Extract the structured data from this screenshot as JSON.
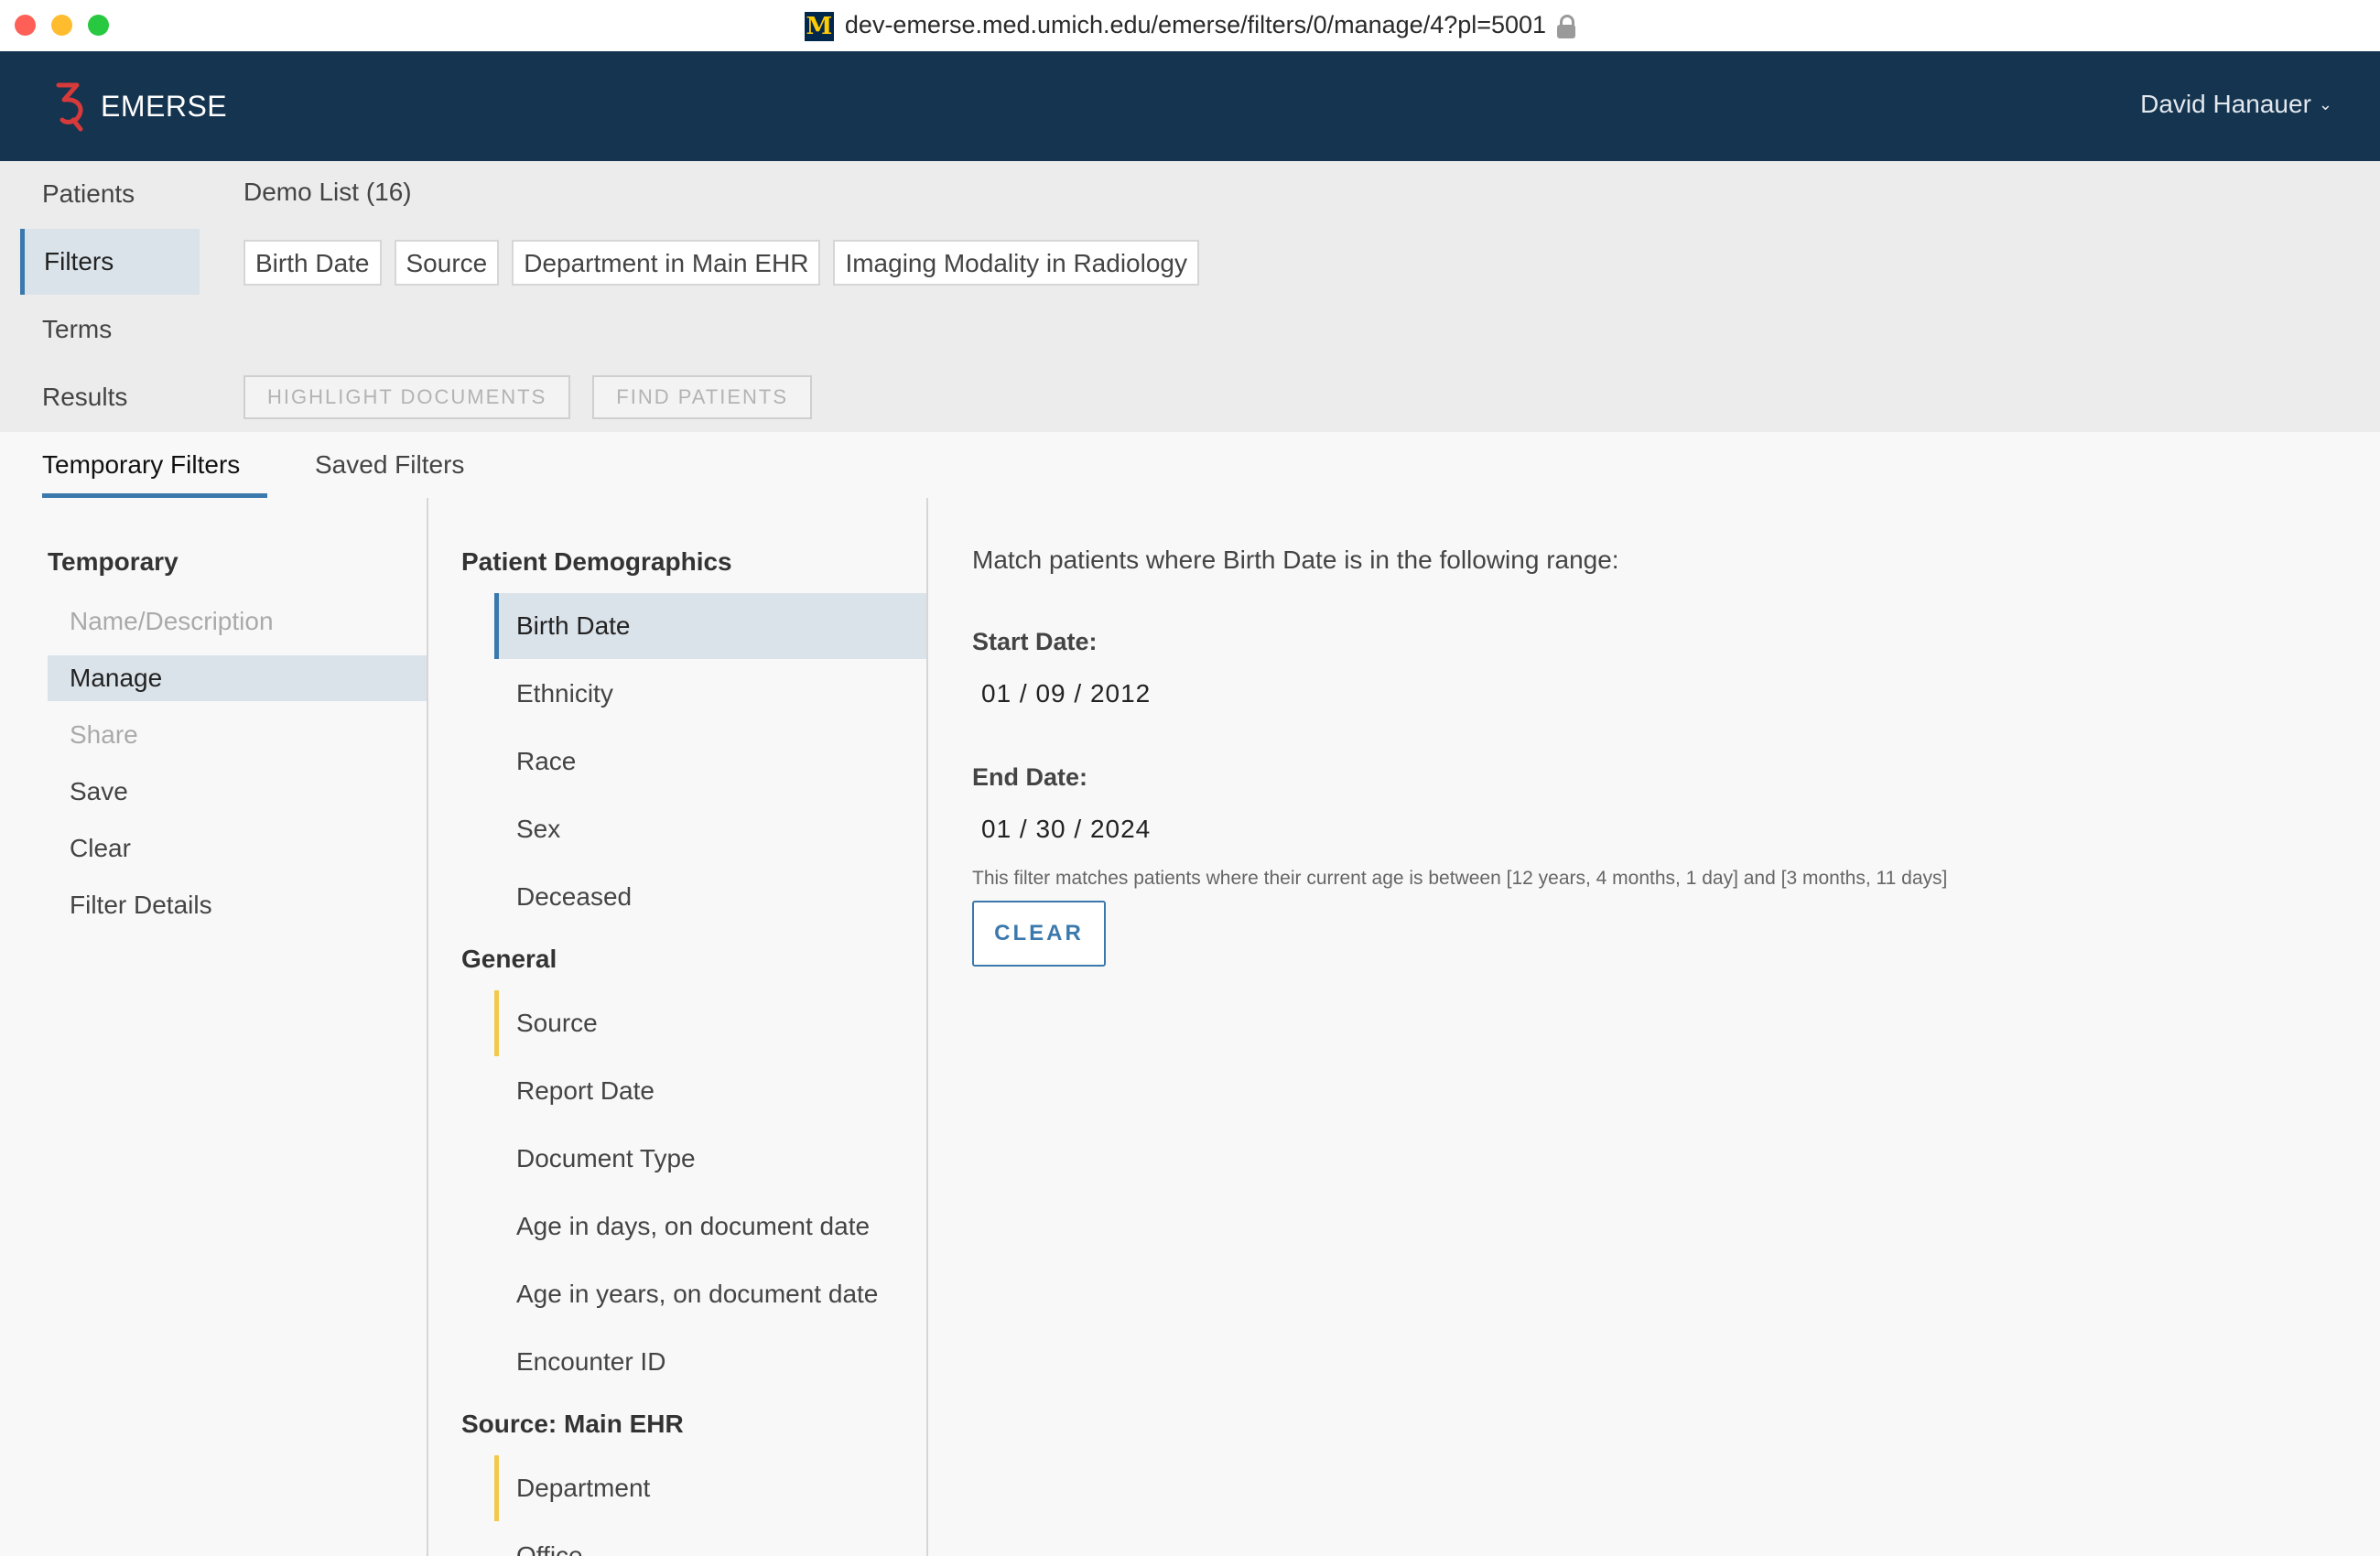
{
  "browser": {
    "url": "dev-emerse.med.umich.edu/emerse/filters/0/manage/4?pl=5001",
    "favicon_letter": "M"
  },
  "app": {
    "name": "EMERSE",
    "user": "David Hanauer",
    "brand_color": "#14344f",
    "accent_color": "#3b79ad"
  },
  "nav": {
    "items": [
      "Patients",
      "Filters",
      "Terms",
      "Results"
    ],
    "active": "Filters"
  },
  "list": {
    "title": "Demo List (16)"
  },
  "filter_chips": [
    "Birth Date",
    "Source",
    "Department in Main EHR",
    "Imaging Modality in Radiology"
  ],
  "actions": {
    "highlight": "HIGHLIGHT DOCUMENTS",
    "find": "FIND PATIENTS"
  },
  "tabs": [
    "Temporary Filters",
    "Saved Filters"
  ],
  "side": {
    "heading": "Temporary",
    "items": [
      "Name/Description",
      "Manage",
      "Share",
      "Save",
      "Clear",
      "Filter Details"
    ]
  },
  "filters": {
    "groups": [
      {
        "heading": "Patient Demographics",
        "items": [
          "Birth Date",
          "Ethnicity",
          "Race",
          "Sex",
          "Deceased"
        ]
      },
      {
        "heading": "General",
        "items": [
          "Source",
          "Report Date",
          "Document Type",
          "Age in days, on document date",
          "Age in years, on document date",
          "Encounter ID"
        ]
      },
      {
        "heading": "Source: Main EHR",
        "items": [
          "Department",
          "Office"
        ]
      }
    ]
  },
  "detail": {
    "description": "Match patients where Birth Date is in the following range:",
    "start_label": "Start Date:",
    "start_value": "01 / 09 / 2012",
    "end_label": "End Date:",
    "end_value": "01 / 30 / 2024",
    "note": "This filter matches patients where their current age is between [12 years, 4 months, 1 day] and [3 months, 11 days]",
    "clear": "CLEAR"
  }
}
